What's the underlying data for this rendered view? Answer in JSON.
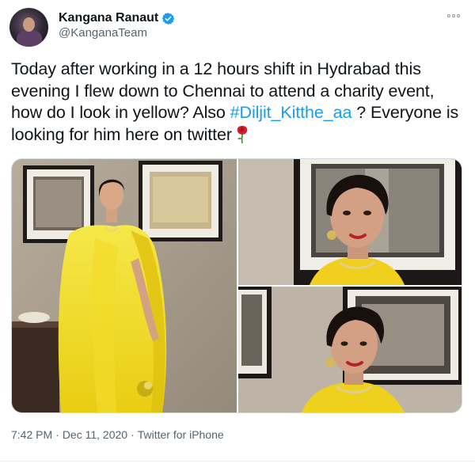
{
  "author": {
    "display_name": "Kangana Ranaut",
    "handle": "@KanganaTeam",
    "verified_icon": "verified-badge-icon",
    "avatar": "profile-avatar"
  },
  "tweet": {
    "text_before": "Today after working in a 12 hours shift in Hydrabad this evening I flew down to Chennai to attend a charity event, how do I look in yellow? Also ",
    "hashtag": "#Diljit_Kitthe_aa",
    "text_after": " ? Everyone is looking for him here on twitter",
    "emoji": "rose-icon"
  },
  "media": {
    "photo_count": 3,
    "photos": [
      "photo-seated-yellow-saree",
      "photo-portrait-closeup",
      "photo-portrait-side"
    ]
  },
  "meta": {
    "time": "7:42 PM",
    "separator": "·",
    "date": "Dec 11, 2020",
    "source": "Twitter for iPhone"
  },
  "colors": {
    "hashtag": "#1d9bf0",
    "verified": "#1d9bf0",
    "secondary_text": "#536471"
  },
  "icons": {
    "more": "more-options-icon"
  }
}
